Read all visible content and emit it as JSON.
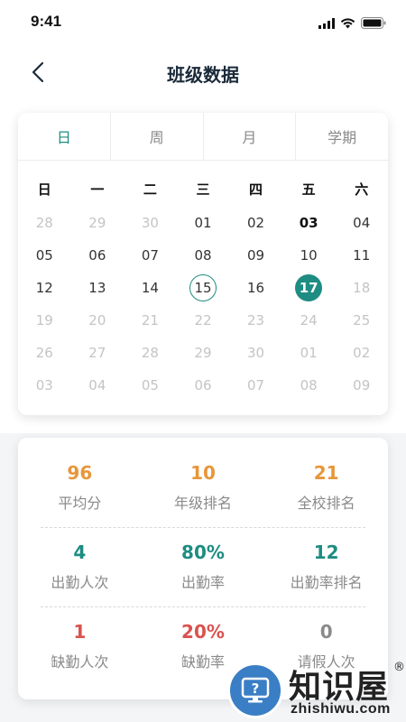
{
  "status_bar": {
    "time": "9:41"
  },
  "header": {
    "title": "班级数据"
  },
  "tabs": [
    {
      "label": "日",
      "active": true
    },
    {
      "label": "周",
      "active": false
    },
    {
      "label": "月",
      "active": false
    },
    {
      "label": "学期",
      "active": false
    }
  ],
  "calendar": {
    "weekdays": [
      "日",
      "一",
      "二",
      "三",
      "四",
      "五",
      "六"
    ],
    "days": [
      {
        "label": "28",
        "state": "muted"
      },
      {
        "label": "29",
        "state": "muted"
      },
      {
        "label": "30",
        "state": "muted"
      },
      {
        "label": "01",
        "state": "normal"
      },
      {
        "label": "02",
        "state": "normal"
      },
      {
        "label": "03",
        "state": "bold"
      },
      {
        "label": "04",
        "state": "normal"
      },
      {
        "label": "05",
        "state": "normal"
      },
      {
        "label": "06",
        "state": "normal"
      },
      {
        "label": "07",
        "state": "normal"
      },
      {
        "label": "08",
        "state": "normal"
      },
      {
        "label": "09",
        "state": "normal"
      },
      {
        "label": "10",
        "state": "normal"
      },
      {
        "label": "11",
        "state": "normal"
      },
      {
        "label": "12",
        "state": "normal"
      },
      {
        "label": "13",
        "state": "normal"
      },
      {
        "label": "14",
        "state": "normal"
      },
      {
        "label": "15",
        "state": "today"
      },
      {
        "label": "16",
        "state": "normal"
      },
      {
        "label": "17",
        "state": "selected"
      },
      {
        "label": "18",
        "state": "muted"
      },
      {
        "label": "19",
        "state": "muted"
      },
      {
        "label": "20",
        "state": "muted"
      },
      {
        "label": "21",
        "state": "muted"
      },
      {
        "label": "22",
        "state": "muted"
      },
      {
        "label": "23",
        "state": "muted"
      },
      {
        "label": "24",
        "state": "muted"
      },
      {
        "label": "25",
        "state": "muted"
      },
      {
        "label": "26",
        "state": "muted"
      },
      {
        "label": "27",
        "state": "muted"
      },
      {
        "label": "28",
        "state": "muted"
      },
      {
        "label": "29",
        "state": "muted"
      },
      {
        "label": "30",
        "state": "muted"
      },
      {
        "label": "01",
        "state": "muted"
      },
      {
        "label": "02",
        "state": "muted"
      },
      {
        "label": "03",
        "state": "muted"
      },
      {
        "label": "04",
        "state": "muted"
      },
      {
        "label": "05",
        "state": "muted"
      },
      {
        "label": "06",
        "state": "muted"
      },
      {
        "label": "07",
        "state": "muted"
      },
      {
        "label": "08",
        "state": "muted"
      },
      {
        "label": "09",
        "state": "muted"
      }
    ]
  },
  "stats": {
    "row1": [
      {
        "value": "96",
        "label": "平均分",
        "color": "orange"
      },
      {
        "value": "10",
        "label": "年级排名",
        "color": "orange"
      },
      {
        "value": "21",
        "label": "全校排名",
        "color": "orange"
      }
    ],
    "row2": [
      {
        "value": "4",
        "label": "出勤人次",
        "color": "teal"
      },
      {
        "value": "80%",
        "label": "出勤率",
        "color": "teal"
      },
      {
        "value": "12",
        "label": "出勤率排名",
        "color": "teal"
      }
    ],
    "row3": [
      {
        "value": "1",
        "label": "缺勤人次",
        "color": "red"
      },
      {
        "value": "20%",
        "label": "缺勤率",
        "color": "red"
      },
      {
        "value": "0",
        "label": "请假人次",
        "color": "gray"
      }
    ]
  },
  "colors": {
    "accent": "#1e8c82",
    "orange": "#e8963a",
    "red": "#d9534f",
    "gray": "#8a8a8a"
  },
  "watermark": {
    "title": "知识屋",
    "reg": "®",
    "url": "zhishiwu.com"
  }
}
